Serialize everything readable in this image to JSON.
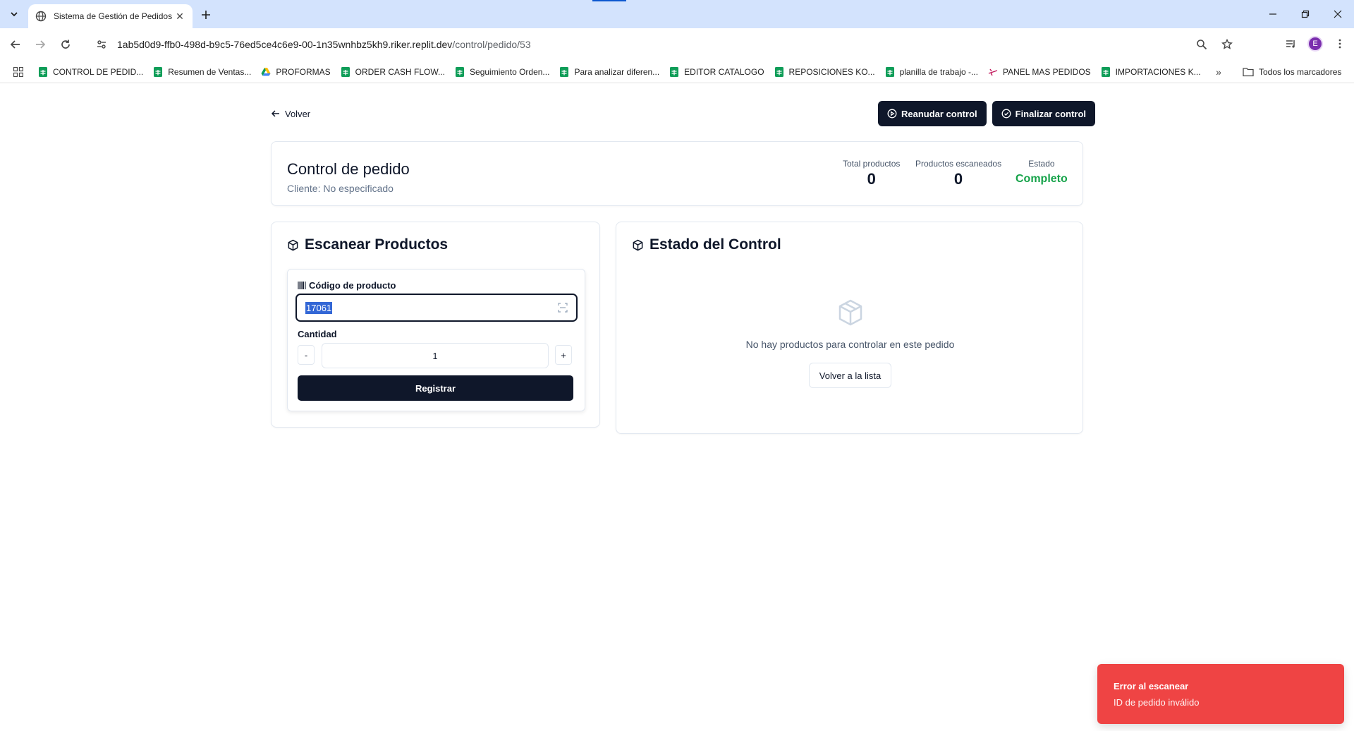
{
  "browser": {
    "tab_title": "Sistema de Gestión de Pedidos",
    "url_host": "1ab5d0d9-ffb0-498d-b9c5-76ed5ce4c6e9-00-1n35wnhbz5kh9.riker.replit.dev",
    "url_path": "/control/pedido/53",
    "avatar_letter": "E"
  },
  "bookmarks": [
    {
      "label": "CONTROL DE PEDID...",
      "icon": "sheets-icon"
    },
    {
      "label": "Resumen de Ventas...",
      "icon": "sheets-icon"
    },
    {
      "label": "PROFORMAS",
      "icon": "drive-icon"
    },
    {
      "label": "ORDER CASH FLOW...",
      "icon": "sheets-icon"
    },
    {
      "label": "Seguimiento Orden...",
      "icon": "sheets-icon"
    },
    {
      "label": "Para analizar diferen...",
      "icon": "sheets-icon"
    },
    {
      "label": "EDITOR CATALOGO",
      "icon": "sheets-icon"
    },
    {
      "label": "REPOSICIONES KO...",
      "icon": "sheets-icon"
    },
    {
      "label": "planilla de trabajo -...",
      "icon": "sheets-icon"
    },
    {
      "label": "PANEL MAS PEDIDOS",
      "icon": "plane-icon"
    },
    {
      "label": "IMPORTACIONES K...",
      "icon": "sheets-icon"
    }
  ],
  "bookmarks_all": "Todos los marcadores",
  "page": {
    "back_label": "Volver",
    "resume_label": "Reanudar control",
    "finish_label": "Finalizar control",
    "title": "Control de pedido",
    "client": "Cliente: No especificado",
    "stats": {
      "total_label": "Total productos",
      "total_value": "0",
      "scanned_label": "Productos escaneados",
      "scanned_value": "0",
      "state_label": "Estado",
      "state_value": "Completo"
    },
    "scan": {
      "title": "Escanear Productos",
      "code_label": "Código de producto",
      "code_value": "17061",
      "qty_label": "Cantidad",
      "minus": "-",
      "qty_value": "1",
      "plus": "+",
      "register_label": "Registrar"
    },
    "status": {
      "title": "Estado del Control",
      "empty_text": "No hay productos para controlar en este pedido",
      "back_to_list": "Volver a la lista"
    }
  },
  "toast": {
    "title": "Error al escanear",
    "description": "ID de pedido inválido"
  },
  "colors": {
    "primary": "#0f172a",
    "success": "#16a34a",
    "error": "#ef4444",
    "tabstrip": "#d3e3fd"
  }
}
